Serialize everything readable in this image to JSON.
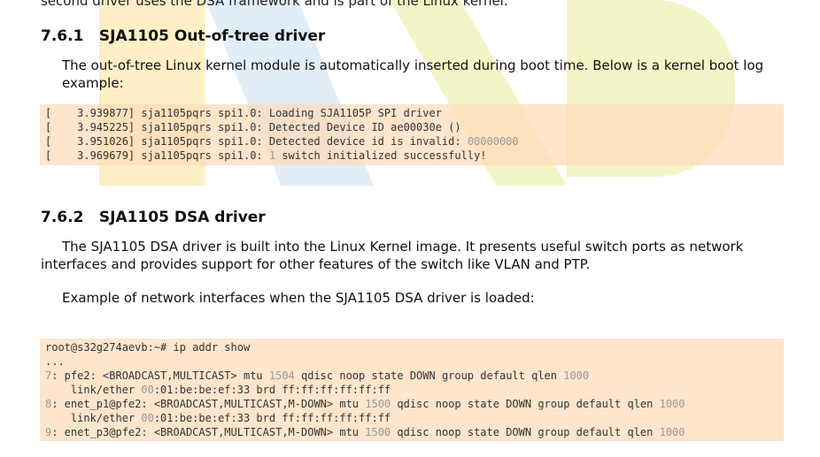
{
  "top_cut_text": "second driver uses the DSA framework and is part of the Linux kernel.",
  "section1": {
    "number": "7.6.1",
    "title": "SJA1105 Out-of-tree driver",
    "paragraph": "The out-of-tree Linux kernel module is automatically inserted during boot time. Below is a kernel boot log example:"
  },
  "boot_log": [
    [
      {
        "t": "[    3.939877] sja1105pqrs spi1.0: Loading SJA1105P SPI driver"
      }
    ],
    [
      {
        "t": "[    3.945225] sja1105pqrs spi1.0: Detected Device ID ae00030e ()"
      }
    ],
    [
      {
        "t": "[    3.951026] sja1105pqrs spi1.0: Detected device id is invalid: "
      },
      {
        "t": "00000000",
        "n": true
      }
    ],
    [
      {
        "t": "[    3.969679] sja1105pqrs spi1.0: "
      },
      {
        "t": "1",
        "n": true
      },
      {
        "t": " switch initialized successfully!"
      }
    ]
  ],
  "section2": {
    "number": "7.6.2",
    "title": "SJA1105 DSA driver",
    "paragraph1": "The SJA1105 DSA driver is built into the Linux Kernel image. It presents useful switch ports as network interfaces and provides support for other features of the switch like VLAN and PTP.",
    "paragraph2": "Example of network interfaces when the SJA1105 DSA driver is loaded:"
  },
  "ip_output": [
    [
      {
        "t": "root@s32g274aevb:~# ip addr show"
      }
    ],
    [
      {
        "t": "..."
      }
    ],
    [
      {
        "t": "7",
        "n": true
      },
      {
        "t": ": pfe2: <BROADCAST,MULTICAST> mtu "
      },
      {
        "t": "1504",
        "n": true
      },
      {
        "t": " qdisc noop state DOWN group default qlen "
      },
      {
        "t": "1000",
        "n": true
      }
    ],
    [
      {
        "t": "    link/ether "
      },
      {
        "t": "00",
        "n": true
      },
      {
        "t": ":01:be:be:ef:33 brd ff:ff:ff:ff:ff:ff"
      }
    ],
    [
      {
        "t": "8",
        "n": true
      },
      {
        "t": ": enet_p1@pfe2: <BROADCAST,MULTICAST,M-DOWN> mtu "
      },
      {
        "t": "1500",
        "n": true
      },
      {
        "t": " qdisc noop state DOWN group default qlen "
      },
      {
        "t": "1000",
        "n": true
      }
    ],
    [
      {
        "t": "    link/ether "
      },
      {
        "t": "00",
        "n": true
      },
      {
        "t": ":01:be:be:ef:33 brd ff:ff:ff:ff:ff:ff"
      }
    ],
    [
      {
        "t": "9",
        "n": true
      },
      {
        "t": ": enet_p3@pfe2: <BROADCAST,MULTICAST,M-DOWN> mtu "
      },
      {
        "t": "1500",
        "n": true
      },
      {
        "t": " qdisc noop state DOWN group default qlen "
      },
      {
        "t": "1000",
        "n": true
      }
    ]
  ]
}
